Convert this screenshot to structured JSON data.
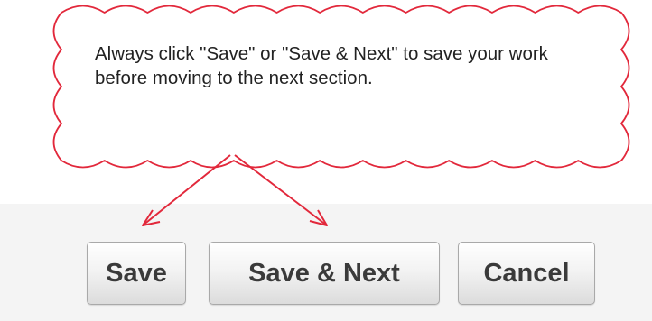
{
  "callout": {
    "text": "Always click \"Save\" or \"Save & Next\" to save your work before moving to the next section.",
    "border_color": "#e2283b"
  },
  "buttons": {
    "save_label": "Save",
    "save_next_label": "Save & Next",
    "cancel_label": "Cancel"
  }
}
